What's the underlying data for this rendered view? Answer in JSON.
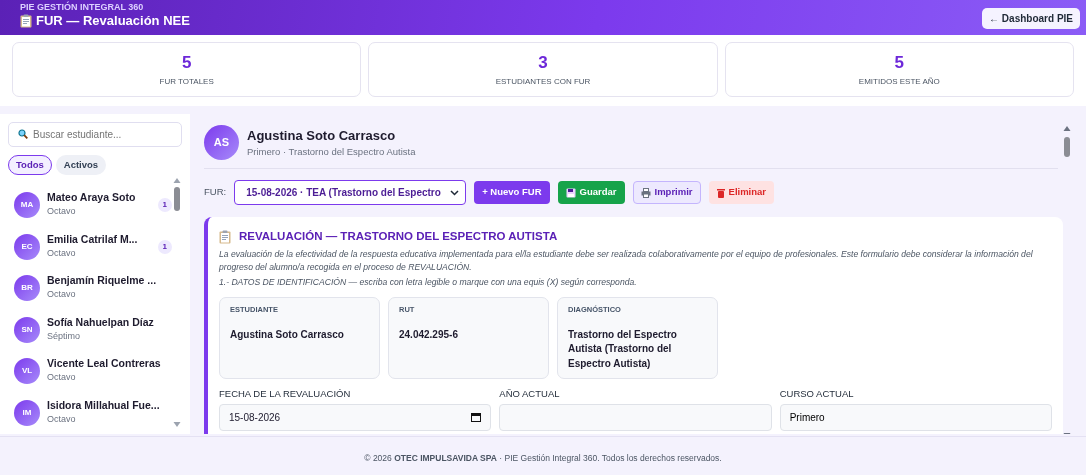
{
  "header": {
    "subtitle": "PIE GESTIÓN INTEGRAL 360",
    "title": "FUR — Revaluación NEE",
    "back_button": "← Dashboard PIE"
  },
  "stats": [
    {
      "value": "5",
      "label": "FUR TOTALES"
    },
    {
      "value": "3",
      "label": "ESTUDIANTES CON FUR"
    },
    {
      "value": "5",
      "label": "EMITIDOS ESTE AÑO"
    }
  ],
  "sidebar": {
    "search_placeholder": "Buscar estudiante...",
    "filters": [
      {
        "label": "Todos",
        "selected": true
      },
      {
        "label": "Activos",
        "selected": false
      }
    ],
    "students": [
      {
        "initials": "MA",
        "name": "Mateo Araya Soto",
        "course": "Octavo",
        "badge": "1"
      },
      {
        "initials": "EC",
        "name": "Emilia Catrilaf M...",
        "course": "Octavo",
        "badge": "1"
      },
      {
        "initials": "BR",
        "name": "Benjamín Riquelme ...",
        "course": "Octavo"
      },
      {
        "initials": "SN",
        "name": "Sofía Nahuelpan Díaz",
        "course": "Séptimo"
      },
      {
        "initials": "VL",
        "name": "Vicente Leal Contreras",
        "course": "Octavo"
      },
      {
        "initials": "IM",
        "name": "Isidora Millahual Fue...",
        "course": "Octavo"
      }
    ]
  },
  "student": {
    "initials": "AS",
    "name": "Agustina Soto Carrasco",
    "subtitle": "Primero · Trastorno del Espectro Autista"
  },
  "toolbar": {
    "label": "FUR:",
    "select_value": "15-08-2026 · TEA (Trastorno del Espectro",
    "buttons": [
      {
        "label": "+ Nuevo FUR",
        "kind": "new"
      },
      {
        "label": "Guardar",
        "kind": "save"
      },
      {
        "label": "Imprimir",
        "kind": "print"
      },
      {
        "label": "Eliminar",
        "kind": "delete"
      }
    ]
  },
  "form": {
    "title": "REVALUACIÓN — TRASTORNO DEL ESPECTRO AUTISTA",
    "intro": "La evaluación de la efectividad de la respuesta educativa implementada para el/la estudiante debe ser realizada colaborativamente por el equipo de profesionales. Este formulario debe considerar la información del progreso del alumno/a recogida en el proceso de REVALUACIÓN.",
    "section": "1.- DATOS DE IDENTIFICACIÓN — escriba con letra legible o marque con una equis (X) según corresponda.",
    "info": [
      {
        "label": "ESTUDIANTE",
        "value": "Agustina Soto Carrasco"
      },
      {
        "label": "RUT",
        "value": "24.042.295-6"
      },
      {
        "label": "DIAGNÓSTICO",
        "value": "Trastorno del Espectro Autista (Trastorno del Espectro Autista)"
      }
    ],
    "fields": [
      {
        "label": "FECHA DE LA REVALUACIÓN",
        "value": "15-08-2026",
        "kind": "date"
      },
      {
        "label": "AÑO ACTUAL",
        "kind": "text"
      },
      {
        "label": "CURSO ACTUAL",
        "value": "Primero",
        "kind": "text"
      }
    ]
  },
  "footer": "© 2026 **OTEC IMPULSAVIDA SPA** · PIE Gestión Integral 360. Todos los derechos reservados."
}
